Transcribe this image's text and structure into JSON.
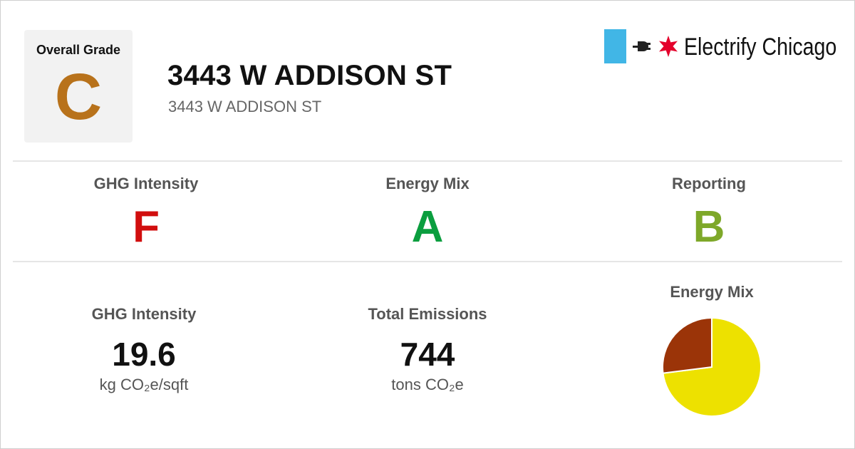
{
  "overall": {
    "label": "Overall Grade",
    "grade": "C",
    "grade_color": "#b8721b"
  },
  "building": {
    "title": "3443 W ADDISON ST",
    "address": "3443 W ADDISON ST"
  },
  "logo": {
    "brand": "Electrify Chicago",
    "flag_color": "#41b6e6",
    "star_color": "#e4002b",
    "icons": [
      "plug-icon",
      "six-point-star-icon"
    ]
  },
  "grades": [
    {
      "label": "GHG Intensity",
      "grade": "F",
      "color": "#d10e0e"
    },
    {
      "label": "Energy Mix",
      "grade": "A",
      "color": "#0b9e3f"
    },
    {
      "label": "Reporting",
      "grade": "B",
      "color": "#7ea829"
    }
  ],
  "metrics": {
    "ghg_intensity": {
      "label": "GHG Intensity",
      "value": "19.6",
      "unit": "kg CO₂e/sqft"
    },
    "total_emissions": {
      "label": "Total Emissions",
      "value": "744",
      "unit": "tons CO₂e"
    }
  },
  "energy_mix": {
    "label": "Energy Mix"
  },
  "chart_data": {
    "type": "pie",
    "title": "Energy Mix",
    "slices": [
      {
        "value": 73,
        "color": "#ede100"
      },
      {
        "value": 27,
        "color": "#9b3408"
      }
    ]
  }
}
